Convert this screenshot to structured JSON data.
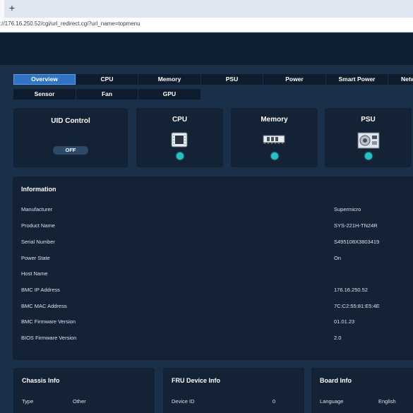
{
  "browser": {
    "new_tab_symbol": "+",
    "url": "://176.16.250.52/cgi/url_redirect.cgi?url_name=topmenu"
  },
  "nav": {
    "tabs": [
      "Overview",
      "CPU",
      "Memory",
      "PSU",
      "Power",
      "Smart Power",
      "Netw",
      "Sensor",
      "Fan",
      "GPU"
    ],
    "active": "Overview"
  },
  "cards": {
    "uid": {
      "title": "UID Control",
      "toggle": "OFF"
    },
    "cpu": {
      "title": "CPU",
      "icon": "cpu-chip-icon"
    },
    "memory": {
      "title": "Memory",
      "icon": "memory-module-icon"
    },
    "psu": {
      "title": "PSU",
      "icon": "power-supply-icon"
    }
  },
  "information": {
    "title": "Information",
    "rows": [
      {
        "label": "Manufacturer",
        "value": "Supermicro"
      },
      {
        "label": "Product Name",
        "value": "SYS-221H-TN24R"
      },
      {
        "label": "Serial Number",
        "value": "S495108X3803419"
      },
      {
        "label": "Power State",
        "value": "On"
      },
      {
        "label": "Host Name",
        "value": ""
      },
      {
        "label": "BMC IP Address",
        "value": "176.16.250.52"
      },
      {
        "label": "BMC MAC Address",
        "value": "7C:C2:55:81:E5:4E"
      },
      {
        "label": "BMC Firmware Version",
        "value": "01.01.23"
      },
      {
        "label": "BIOS Firmware Version",
        "value": "2.0"
      }
    ]
  },
  "bottom_cards": {
    "chassis": {
      "title": "Chassis Info",
      "label": "Type",
      "value": "Other"
    },
    "fru": {
      "title": "FRU Device Info",
      "label": "Device ID",
      "value": "0"
    },
    "board": {
      "title": "Board Info",
      "label": "Language",
      "value": "English"
    }
  },
  "colors": {
    "background": "#1a3049",
    "card": "#132235",
    "tab": "#0f1c2e",
    "active_tab": "#3274c4",
    "status": "#21c3c3"
  }
}
